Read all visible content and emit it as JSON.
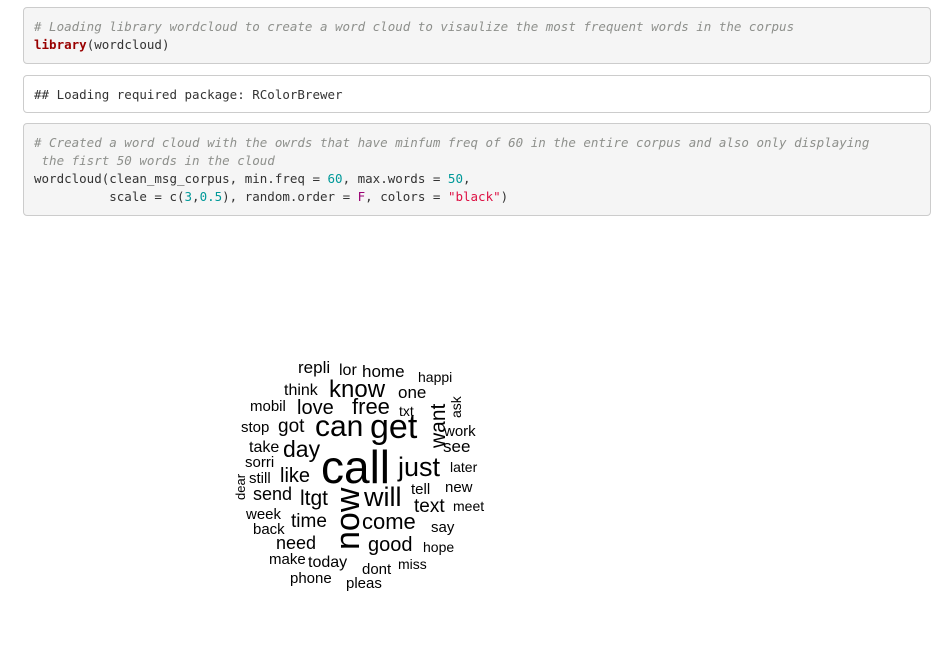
{
  "code1": {
    "comment": "# Loading library wordcloud to create a word cloud to visaulize the most frequent words in the corpus",
    "keyword": "library",
    "arg": "(wordcloud)"
  },
  "output1": {
    "text": "## Loading required package: RColorBrewer"
  },
  "code2": {
    "comment_line1": "# Created a word cloud with the owrds that have minfum freq of 60 in the entire corpus and also only displaying",
    "comment_line2": " the fisrt 50 words in the cloud",
    "line3_a": "wordcloud(clean_msg_corpus, min.freq = ",
    "line3_n1": "60",
    "line3_b": ", max.words = ",
    "line3_n2": "50",
    "line3_c": ",",
    "line4_a": "          scale = c(",
    "line4_n1": "3",
    "line4_b": ",",
    "line4_n2": "0.5",
    "line4_c": "), random.order = ",
    "line4_f": "F",
    "line4_d": ", colors = ",
    "line4_str": "\"black\"",
    "line4_e": ")"
  },
  "wordcloud": {
    "words": [
      {
        "text": "call",
        "size": 46
      },
      {
        "text": "now",
        "size": 34,
        "rotated": true
      },
      {
        "text": "get",
        "size": 34
      },
      {
        "text": "can",
        "size": 30
      },
      {
        "text": "just",
        "size": 27
      },
      {
        "text": "will",
        "size": 27
      },
      {
        "text": "know",
        "size": 24
      },
      {
        "text": "free",
        "size": 22
      },
      {
        "text": "day",
        "size": 23
      },
      {
        "text": "come",
        "size": 22
      },
      {
        "text": "ltgt",
        "size": 21
      },
      {
        "text": "love",
        "size": 20
      },
      {
        "text": "like",
        "size": 20
      },
      {
        "text": "good",
        "size": 20
      },
      {
        "text": "text",
        "size": 19
      },
      {
        "text": "want",
        "size": 21,
        "rotated": true
      },
      {
        "text": "got",
        "size": 19
      },
      {
        "text": "time",
        "size": 19
      },
      {
        "text": "send",
        "size": 18
      },
      {
        "text": "need",
        "size": 18
      },
      {
        "text": "repli",
        "size": 17
      },
      {
        "text": "home",
        "size": 17
      },
      {
        "text": "one",
        "size": 17
      },
      {
        "text": "see",
        "size": 17
      },
      {
        "text": "lor",
        "size": 16
      },
      {
        "text": "think",
        "size": 16
      },
      {
        "text": "take",
        "size": 16
      },
      {
        "text": "today",
        "size": 16
      },
      {
        "text": "mobil",
        "size": 15
      },
      {
        "text": "stop",
        "size": 15
      },
      {
        "text": "work",
        "size": 15
      },
      {
        "text": "sorri",
        "size": 15
      },
      {
        "text": "still",
        "size": 15
      },
      {
        "text": "new",
        "size": 15
      },
      {
        "text": "tell",
        "size": 15
      },
      {
        "text": "week",
        "size": 15
      },
      {
        "text": "back",
        "size": 15
      },
      {
        "text": "say",
        "size": 15
      },
      {
        "text": "make",
        "size": 15
      },
      {
        "text": "phone",
        "size": 15
      },
      {
        "text": "pleas",
        "size": 15
      },
      {
        "text": "dont",
        "size": 15
      },
      {
        "text": "miss",
        "size": 14
      },
      {
        "text": "hope",
        "size": 14
      },
      {
        "text": "later",
        "size": 14
      },
      {
        "text": "meet",
        "size": 14
      },
      {
        "text": "happi",
        "size": 14
      },
      {
        "text": "txt",
        "size": 14
      },
      {
        "text": "ask",
        "size": 14,
        "rotated": true
      },
      {
        "text": "dear",
        "size": 13,
        "rotated": true
      }
    ]
  }
}
